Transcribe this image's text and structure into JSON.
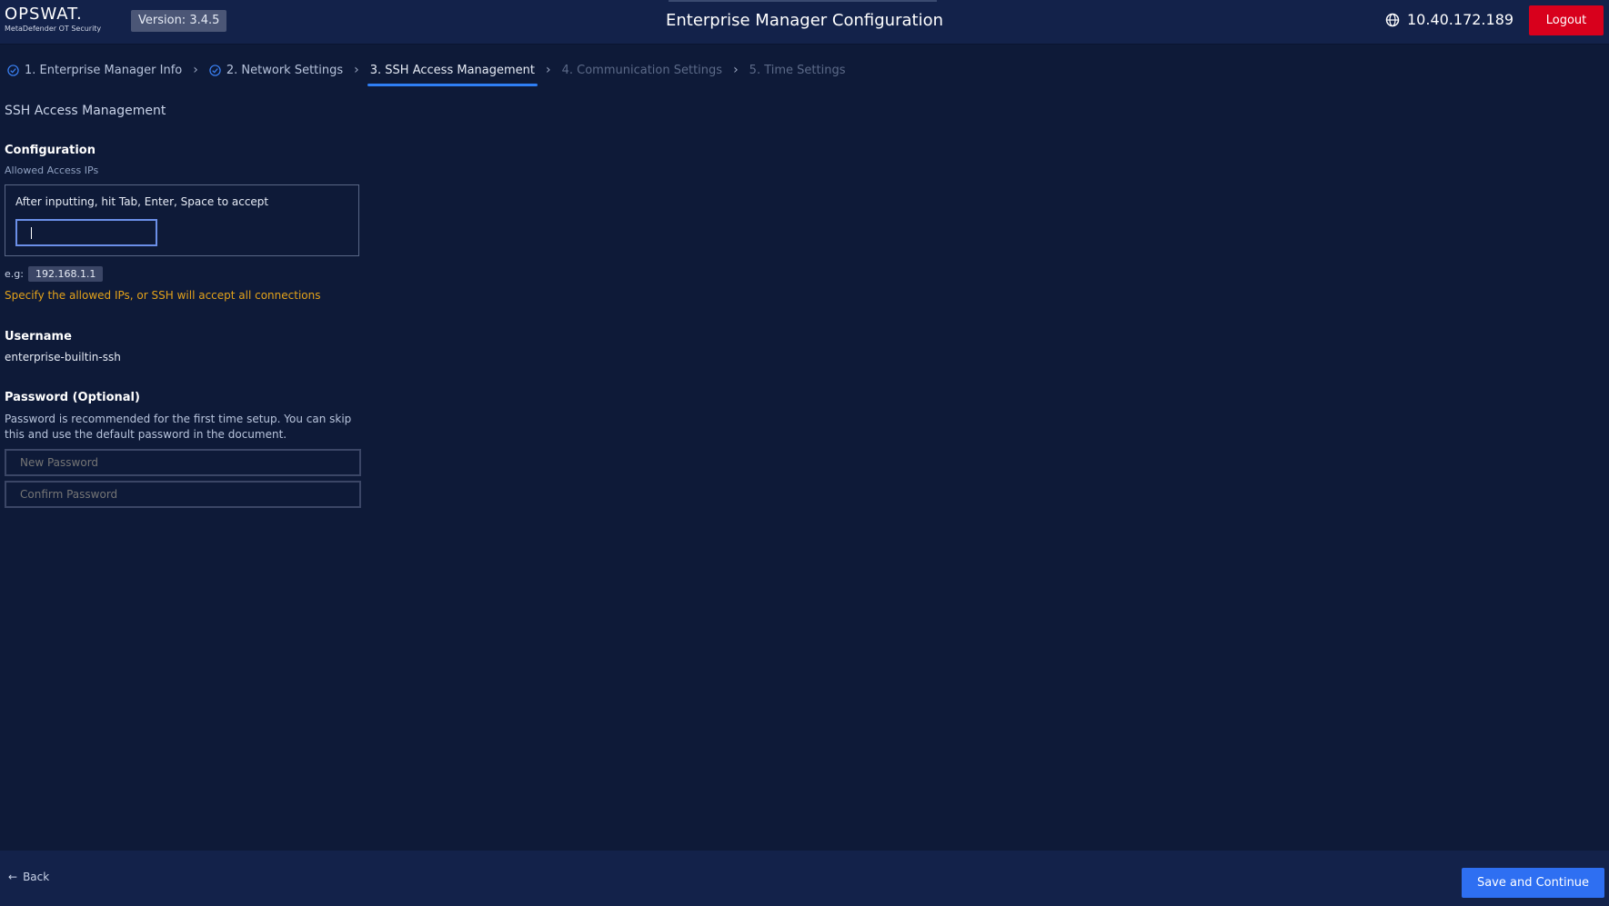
{
  "header": {
    "logo_main": "OPSWAT.",
    "logo_sub": "MetaDefender OT Security",
    "version": "Version: 3.4.5",
    "title": "Enterprise Manager Configuration",
    "ip": "10.40.172.189",
    "logout_label": "Logout"
  },
  "steps": [
    {
      "label": "1. Enterprise Manager Info",
      "state": "done"
    },
    {
      "label": "2. Network Settings",
      "state": "done"
    },
    {
      "label": "3. SSH Access Management",
      "state": "active"
    },
    {
      "label": "4. Communication Settings",
      "state": "pending"
    },
    {
      "label": "5. Time Settings",
      "state": "pending"
    }
  ],
  "content": {
    "section_title": "SSH Access Management",
    "configuration_label": "Configuration",
    "allowed_ips_label": "Allowed Access IPs",
    "ip_hint": "After inputting, hit Tab, Enter, Space to accept",
    "ip_value": "",
    "example_prefix": "e.g:",
    "example_value": "192.168.1.1",
    "warning": "Specify the allowed IPs, or SSH will accept all connections",
    "username_label": "Username",
    "username_value": "enterprise-builtin-ssh",
    "password_label": "Password (Optional)",
    "password_desc": "Password is recommended for the first time setup. You can skip this and use the default password in the document.",
    "new_password_placeholder": "New Password",
    "confirm_password_placeholder": "Confirm Password"
  },
  "footer": {
    "back_label": "Back",
    "save_label": "Save and Continue"
  },
  "colors": {
    "background": "#0e1a38",
    "header": "#13224a",
    "accent": "#2f7ff5",
    "logout": "#d8001c",
    "warning": "#e3a21a"
  },
  "icons": {
    "globe": "globe-icon",
    "check": "check-circle-icon",
    "chevron": "chevron-right-icon",
    "back": "arrow-left-icon"
  }
}
